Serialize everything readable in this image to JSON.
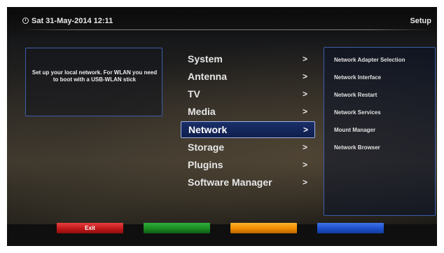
{
  "header": {
    "datetime": "Sat 31-May-2014 12:11",
    "title": "Setup"
  },
  "info": {
    "text": "Set up your local network. For WLAN you need to boot with a USB-WLAN stick"
  },
  "menu": {
    "items": [
      {
        "label": "System",
        "arrow": ">"
      },
      {
        "label": "Antenna",
        "arrow": ">"
      },
      {
        "label": "TV",
        "arrow": ">"
      },
      {
        "label": "Media",
        "arrow": ">"
      },
      {
        "label": "Network",
        "arrow": ">",
        "selected": true
      },
      {
        "label": "Storage",
        "arrow": ">"
      },
      {
        "label": "Plugins",
        "arrow": ">"
      },
      {
        "label": "Software Manager",
        "arrow": ">"
      }
    ]
  },
  "submenu": {
    "items": [
      "Network Adapter Selection",
      "Network Interface",
      "Network Restart",
      "Network Services",
      "Mount Manager",
      "Network Browser"
    ]
  },
  "buttons": {
    "red": "Exit",
    "green": "",
    "yellow": "",
    "blue": ""
  },
  "colors": {
    "red": "#c01818",
    "green": "#1a8a22",
    "yellow": "#f08c00",
    "blue": "#1d4fcc",
    "frame": "#3d5da8"
  }
}
